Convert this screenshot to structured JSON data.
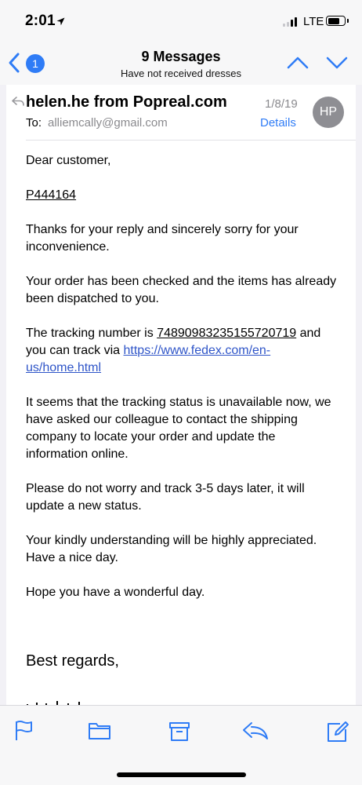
{
  "status_bar": {
    "time": "2:01",
    "network": "LTE"
  },
  "nav": {
    "unread_count": "1",
    "title": "9 Messages",
    "subtitle": "Have not received dresses"
  },
  "email": {
    "sender": "helen.he from Popreal.com",
    "date": "1/8/19",
    "avatar_initials": "HP",
    "to_label": "To:",
    "to_address": "alliemcally@gmail.com",
    "details_label": "Details",
    "greeting": "Dear customer,",
    "order_id": "P444164",
    "para1": "Thanks for your reply and sincerely sorry for your inconvenience.",
    "para2": "Your order has been checked and the items  has already been dispatched to you.",
    "tracking_intro": "The tracking number is ",
    "tracking_number": "74890983235155720719",
    "tracking_after": " and you can track via ",
    "tracking_url": "https://www.fedex.com/en-us/home.html",
    "para4": "It seems that the tracking status is unavailable now, we have asked our colleague to contact the shipping company to locate your order and update the information online.",
    "para5": "Please do not worry and track 3-5 days later, it will update a new status.",
    "para6": "Your kindly understanding will be highly appreciated. Have a nice day.",
    "para7": "Hope you have a wonderful day.",
    "closing": "Best regards,"
  },
  "toolbar": {
    "icons": [
      "flag-icon",
      "folder-icon",
      "archive-icon",
      "reply-icon",
      "compose-icon"
    ]
  },
  "colors": {
    "accent": "#2f7cf6",
    "link": "#2f55c8",
    "secondary_text": "#8a8a8e"
  }
}
